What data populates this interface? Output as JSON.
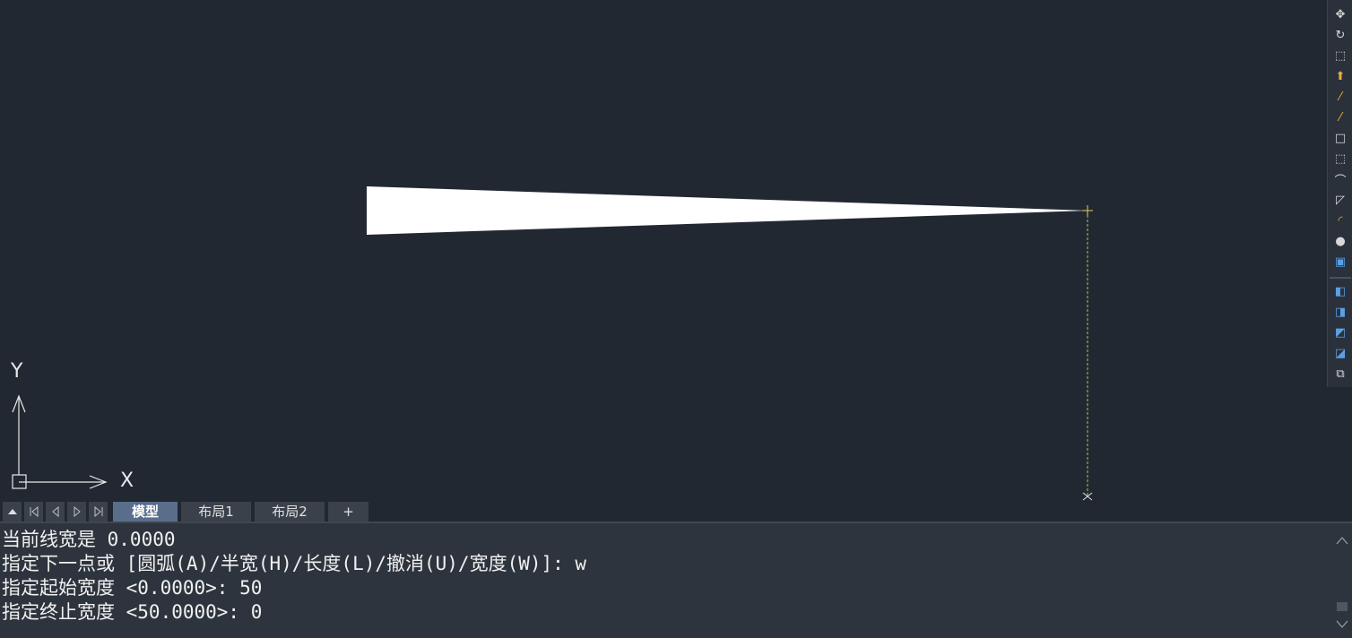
{
  "viewport": {
    "ucs": {
      "y_label": "Y",
      "x_label": "X"
    }
  },
  "right_toolbar": {
    "tools": [
      {
        "name": "move-icon",
        "glyph": "✥",
        "color": "#d8d8d8"
      },
      {
        "name": "rotate-icon",
        "glyph": "↻",
        "color": "#d8d8d8"
      },
      {
        "name": "scale-icon",
        "glyph": "⬚",
        "color": "#d8d8d8"
      },
      {
        "name": "stretch-icon",
        "glyph": "⬆",
        "color": "#e6b040"
      },
      {
        "name": "trim-icon",
        "glyph": "⁄",
        "color": "#e6b040"
      },
      {
        "name": "extend-icon",
        "glyph": "⁄",
        "color": "#e6b040"
      },
      {
        "name": "break-at-point-icon",
        "glyph": "□",
        "color": "#d8d8d8"
      },
      {
        "name": "break-icon",
        "glyph": "⬚",
        "color": "#d8d8d8"
      },
      {
        "name": "join-icon",
        "glyph": "⌒",
        "color": "#d8d8d8"
      },
      {
        "name": "chamfer-icon",
        "glyph": "◸",
        "color": "#d8d8d8"
      },
      {
        "name": "fillet-icon",
        "glyph": "◜",
        "color": "#e6b040"
      },
      {
        "name": "blend-icon",
        "glyph": "●",
        "color": "#d8d8d8"
      },
      {
        "name": "explode-icon",
        "glyph": "▣",
        "color": "#5aa0e6"
      },
      {
        "name": "bring-to-front-icon",
        "glyph": "◧",
        "color": "#5aa0e6"
      },
      {
        "name": "send-to-back-icon",
        "glyph": "◨",
        "color": "#5aa0e6"
      },
      {
        "name": "bring-above-icon",
        "glyph": "◩",
        "color": "#5aa0e6"
      },
      {
        "name": "send-under-icon",
        "glyph": "◪",
        "color": "#5aa0e6"
      },
      {
        "name": "copy-objects-icon",
        "glyph": "⧉",
        "color": "#d8d8d8"
      }
    ]
  },
  "tabs": {
    "items": [
      {
        "label": "模型",
        "active": true
      },
      {
        "label": "布局1",
        "active": false
      },
      {
        "label": "布局2",
        "active": false
      },
      {
        "label": "+",
        "active": false
      }
    ]
  },
  "command": {
    "lines": [
      "当前线宽是 0.0000",
      "指定下一点或 [圆弧(A)/半宽(H)/长度(L)/撤消(U)/宽度(W)]: w",
      "指定起始宽度 <0.0000>: 50",
      "指定终止宽度 <50.0000>: 0"
    ]
  },
  "colors": {
    "background": "#222831",
    "polyline_fill": "#ffffff",
    "rubberband": "#9ad24a",
    "crosshair": "#e0d060"
  }
}
